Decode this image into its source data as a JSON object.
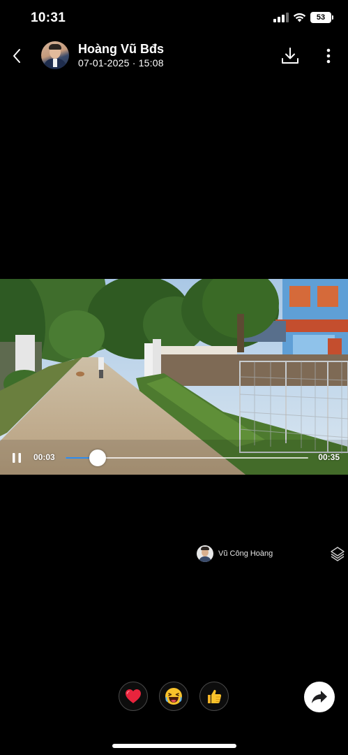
{
  "status_bar": {
    "time": "10:31",
    "battery": "53"
  },
  "header": {
    "sender_name": "Hoàng Vũ Bđs",
    "timestamp": "07-01-2025 · 15:08",
    "back_icon": "chevron-left-icon",
    "download_icon": "download-icon",
    "more_icon": "more-vertical-icon"
  },
  "video": {
    "current_time": "00:03",
    "total_time": "00:35",
    "progress_fraction": 0.133,
    "state": "playing",
    "pause_icon": "pause-icon",
    "accent_color": "#2c8cf0"
  },
  "origin": {
    "name": "Vũ Công Hoàng"
  },
  "reactions": [
    {
      "name": "heart",
      "icon": "heart-icon"
    },
    {
      "name": "haha",
      "icon": "laughing-face-icon"
    },
    {
      "name": "like",
      "icon": "thumbs-up-icon"
    }
  ],
  "share_icon": "share-arrow-icon"
}
